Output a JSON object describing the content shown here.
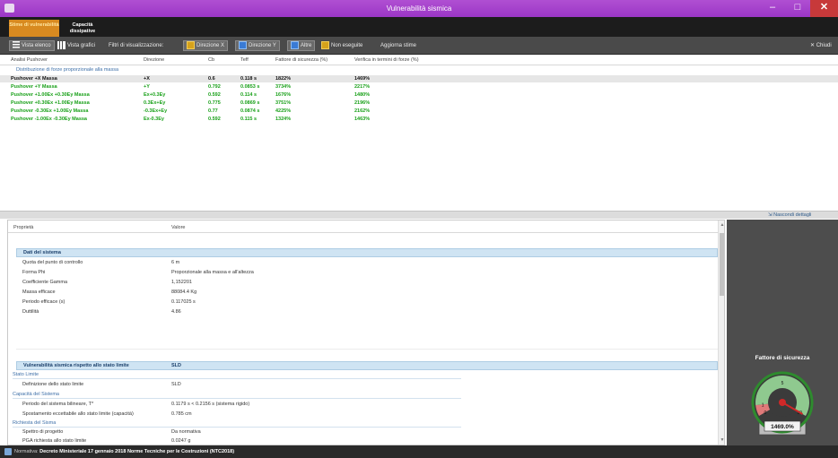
{
  "window": {
    "title": "Vulnerabilità sismica",
    "min_label": "–",
    "max_label": "□",
    "close_label": "✕"
  },
  "ribbon": {
    "tabs": [
      {
        "label": "Stime di vulnerabilità"
      },
      {
        "label": "Capacità dissipative"
      }
    ]
  },
  "toolbar": {
    "view_list": "Vista elenco",
    "view_charts": "Vista grafici",
    "filters_label": "Filtri di visualizzazione:",
    "dir_x": "Direzione X",
    "dir_y": "Direzione Y",
    "others": "Altre",
    "not_run": "Non eseguite",
    "update": "Aggiorna stime",
    "close": "✕ Chiudi"
  },
  "grid": {
    "headers": [
      "Analisi Pushover",
      "Direzione",
      "Cb",
      "Teff",
      "Fattore di sicurezza (%)",
      "Verifica in termini di forze (%)"
    ],
    "group_label": "Distribuzione di forze proporzionale alla massa",
    "rows": [
      {
        "name": "Pushover +X Massa",
        "dir": "+X",
        "cb": "0.6",
        "teff": "0.118 s",
        "fs": "1822%",
        "vf": "1469%"
      },
      {
        "name": "Pushover +Y Massa",
        "dir": "+Y",
        "cb": "0.792",
        "teff": "0.0853 s",
        "fs": "3734%",
        "vf": "2217%"
      },
      {
        "name": "Pushover +1.00Ex +0.30Ey Massa",
        "dir": "Ex+0.3Ey",
        "cb": "0.592",
        "teff": "0.114 s",
        "fs": "1676%",
        "vf": "1480%"
      },
      {
        "name": "Pushover +0.30Ex +1.00Ey Massa",
        "dir": "0.3Ex+Ey",
        "cb": "0.775",
        "teff": "0.0869 s",
        "fs": "3751%",
        "vf": "2196%"
      },
      {
        "name": "Pushover -0.30Ex +1.00Ey Massa",
        "dir": "-0.3Ex+Ey",
        "cb": "0.77",
        "teff": "0.0874 s",
        "fs": "4225%",
        "vf": "2162%"
      },
      {
        "name": "Pushover -1.00Ex -0.30Ey Massa",
        "dir": "Ex-0.3Ey",
        "cb": "0.592",
        "teff": "0.115 s",
        "fs": "1324%",
        "vf": "1463%"
      }
    ]
  },
  "detail_toggle": "Nascondi dettagli",
  "props": {
    "headers": {
      "property": "Proprietà",
      "value": "Valore"
    },
    "section1": "Dati del sistema",
    "system": [
      {
        "k": "Quota del punto di controllo",
        "v": "6 m"
      },
      {
        "k": "Forma Phi",
        "v": "Proporzionale alla massa e all'altezza"
      },
      {
        "k": "Coefficiente Gamma",
        "v": "1,152201"
      },
      {
        "k": "Massa efficace",
        "v": "88084.4 Kg"
      },
      {
        "k": "Periodo efficace (s)",
        "v": "0.117025 s"
      },
      {
        "k": "Duttilità",
        "v": "4.86"
      }
    ],
    "section2": {
      "k": "Vulnerabilità sismica rispetto allo stato limite",
      "v": "SLD"
    },
    "sub_stato": "Stato Limite",
    "stato_rows": [
      {
        "k": "Definizione dello stato limite",
        "v": "SLD"
      }
    ],
    "sub_capacita": "Capacità del Sistema",
    "capacita_rows": [
      {
        "k": "Periodo del sistema bilineare, T*",
        "v": "0.1179 s < 0.2156 s (sistema rigido)"
      },
      {
        "k": "Spostamento eccettabile allo stato limite (capacità)",
        "v": "0.785 cm"
      }
    ],
    "sub_richiesta": "Richiesta del Sisma",
    "richiesta_rows": [
      {
        "k": "Spettro di progetto",
        "v": "Da normativa"
      },
      {
        "k": "PGA richiesta allo stato limite",
        "v": "0.0247 g"
      }
    ]
  },
  "gauge": {
    "title": "Fattore di sicurezza",
    "readout": "1469.0%",
    "value_pct": 1469,
    "marks": [
      "0",
      "1",
      "5",
      "10"
    ],
    "colors": {
      "safe": "#8fc98f",
      "danger": "#e07a7a",
      "rim": "#2e8b2e"
    }
  },
  "status": {
    "label": "Normativa:",
    "value": "Decreto Ministeriale 17 gennaio 2018 Norme Tecniche per le Costruzioni (NTC2018)"
  }
}
